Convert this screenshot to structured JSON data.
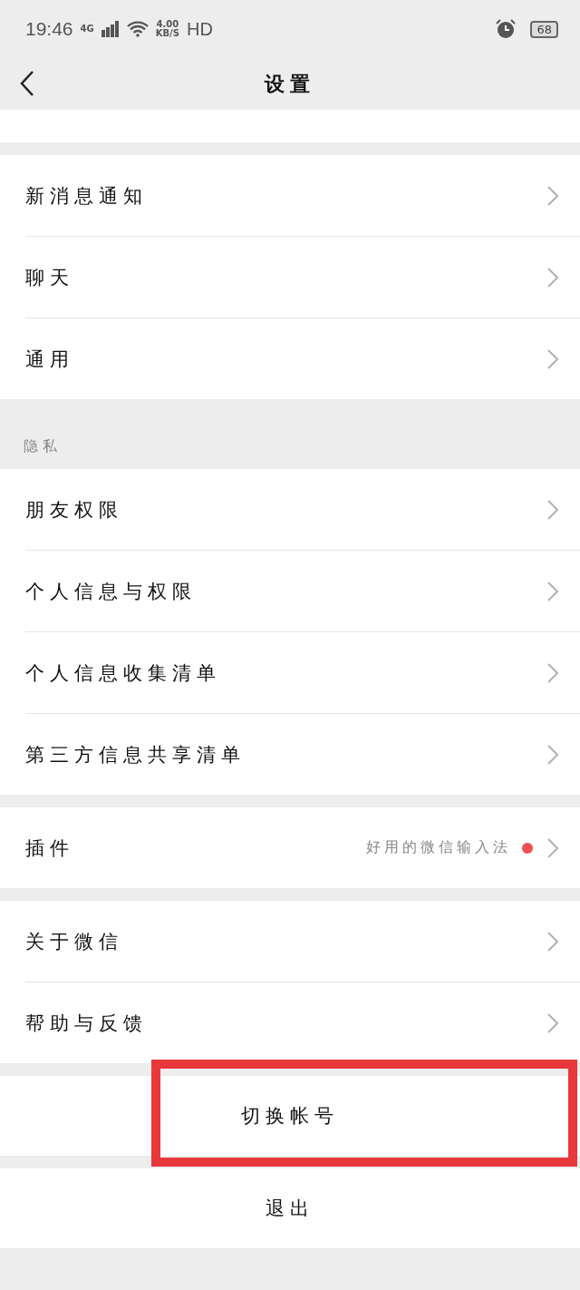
{
  "status_bar": {
    "time": "19:46",
    "network": "4G",
    "speed_value": "4.00",
    "speed_unit": "KB/S",
    "hd": "HD",
    "battery": "68"
  },
  "header": {
    "title": "设置"
  },
  "groups": [
    {
      "items": [
        {
          "label": "新消息通知"
        },
        {
          "label": "聊天"
        },
        {
          "label": "通用"
        }
      ]
    },
    {
      "header": "隐私",
      "items": [
        {
          "label": "朋友权限"
        },
        {
          "label": "个人信息与权限"
        },
        {
          "label": "个人信息收集清单"
        },
        {
          "label": "第三方信息共享清单"
        }
      ]
    },
    {
      "items": [
        {
          "label": "插件",
          "detail": "好用的微信输入法",
          "color": "#f05050"
        }
      ]
    },
    {
      "items": [
        {
          "label": "关于微信"
        },
        {
          "label": "帮助与反馈"
        }
      ]
    }
  ],
  "actions": [
    {
      "label": "切换帐号",
      "highlighted": true
    },
    {
      "label": "退出",
      "highlighted": false
    }
  ]
}
